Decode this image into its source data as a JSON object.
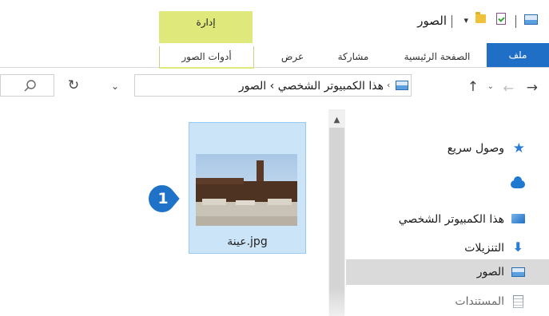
{
  "window": {
    "title": "الصور"
  },
  "quick_access": {
    "icons": [
      "down-arrow-icon",
      "folder-icon",
      "properties-icon",
      "picture-icon"
    ]
  },
  "ribbon": {
    "contextual_group": "إدارة",
    "tabs": [
      {
        "label": "ملف",
        "active": true
      },
      {
        "label": "الصفحة الرئيسية"
      },
      {
        "label": "مشاركة"
      },
      {
        "label": "عرض"
      },
      {
        "label": "أدوات الصور"
      }
    ],
    "file_tab_color": "#1f6fc6",
    "contextual_color": "#dfe87a"
  },
  "address_bar": {
    "path_text": "هذا الكمبيوتر الشخصي  ›  الصور",
    "separator": "›"
  },
  "navigation": {
    "items": [
      {
        "label": "وصول سريع",
        "icon": "star-icon"
      },
      {
        "label": "",
        "icon": "cloud-icon"
      },
      {
        "label": "هذا الكمبيوتر الشخصي",
        "icon": "computer-icon"
      },
      {
        "label": "التنزيلات",
        "icon": "download-icon"
      },
      {
        "label": "الصور",
        "icon": "pictures-icon",
        "selected": true
      },
      {
        "label": "المستندات",
        "icon": "documents-icon"
      }
    ]
  },
  "content": {
    "files": [
      {
        "name": "عينة.jpg",
        "selected": true
      }
    ],
    "callout": "1",
    "callout_color": "#1e72c7"
  }
}
